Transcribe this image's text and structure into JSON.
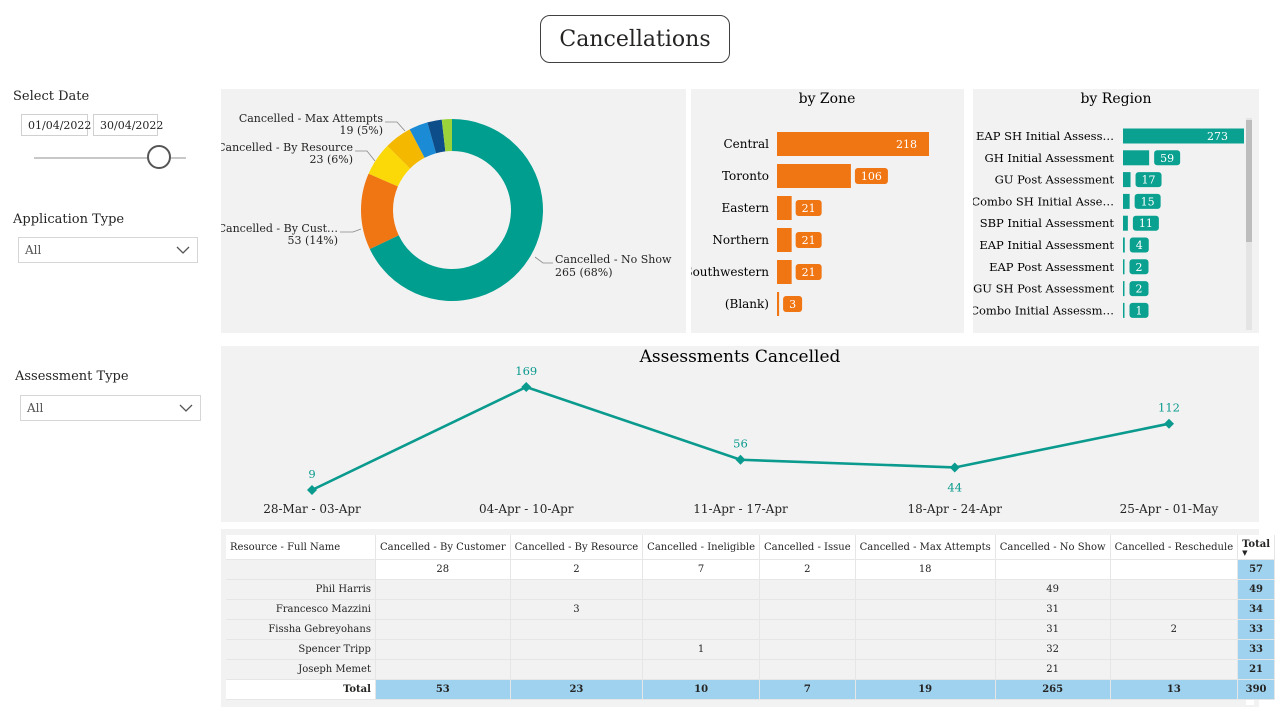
{
  "page_title": "Cancellations",
  "filters": {
    "select_date_label": "Select Date",
    "date_start": "01/04/2022",
    "date_end": "30/04/2022",
    "application_type_label": "Application Type",
    "application_type_value": "All",
    "assessment_type_label": "Assessment Type",
    "assessment_type_value": "All"
  },
  "donut": {
    "labels": [
      {
        "name": "Cancelled - Max Attempts",
        "value": "19 (5%)"
      },
      {
        "name": "Cancelled - By Resource",
        "value": "23 (6%)"
      },
      {
        "name": "Cancelled - By Cust…",
        "value": "53 (14%)"
      },
      {
        "name": "Cancelled - No Show",
        "value": "265 (68%)"
      }
    ],
    "slices": [
      {
        "value": 265,
        "color": "#009e8e"
      },
      {
        "value": 53,
        "color": "#f07513"
      },
      {
        "value": 23,
        "color": "#fbd808"
      },
      {
        "value": 19,
        "color": "#f5b800"
      },
      {
        "value": 13,
        "color": "#1a8bd4"
      },
      {
        "value": 10,
        "color": "#0d4e8a"
      },
      {
        "value": 7,
        "color": "#9ad43a"
      }
    ]
  },
  "zone": {
    "title": "by Zone",
    "color": "#f07513",
    "items": [
      {
        "label": "Central",
        "value": 218
      },
      {
        "label": "Toronto",
        "value": 106
      },
      {
        "label": "Eastern",
        "value": 21
      },
      {
        "label": "Northern",
        "value": 21
      },
      {
        "label": "Southwestern",
        "value": 21
      },
      {
        "label": "(Blank)",
        "value": 3
      }
    ]
  },
  "region": {
    "title": "by Region",
    "color": "#0aa191",
    "items": [
      {
        "label": "EAP SH Initial Assess…",
        "value": 273
      },
      {
        "label": "GH Initial Assessment",
        "value": 59
      },
      {
        "label": "GU Post Assessment",
        "value": 17
      },
      {
        "label": "Combo SH Initial Asse…",
        "value": 15
      },
      {
        "label": "SBP Initial Assessment",
        "value": 11
      },
      {
        "label": "EAP Initial Assessment",
        "value": 4
      },
      {
        "label": "EAP Post Assessment",
        "value": 2
      },
      {
        "label": "GU SH Post Assessment",
        "value": 2
      },
      {
        "label": "Combo Initial Assessm…",
        "value": 1
      }
    ]
  },
  "chart_data": {
    "type": "line",
    "title": "Assessments Cancelled",
    "categories": [
      "28-Mar - 03-Apr",
      "04-Apr - 10-Apr",
      "11-Apr - 17-Apr",
      "18-Apr - 24-Apr",
      "25-Apr - 01-May"
    ],
    "series": [
      {
        "values": [
          9,
          169,
          56,
          44,
          112
        ]
      }
    ],
    "color": "#0a9a8e",
    "xlabel": "",
    "ylabel": "",
    "grid": false
  },
  "matrix": {
    "columns": [
      "Resource - Full Name",
      "Cancelled - By Customer",
      "Cancelled - By Resource",
      "Cancelled - Ineligible",
      "Cancelled - Issue",
      "Cancelled - Max Attempts",
      "Cancelled - No Show",
      "Cancelled - Reschedule",
      "Total"
    ],
    "rows": [
      [
        "",
        "28",
        "2",
        "7",
        "2",
        "18",
        "",
        "",
        "57"
      ],
      [
        "Phil Harris",
        "",
        "",
        "",
        "",
        "",
        "49",
        "",
        "49"
      ],
      [
        "Francesco Mazzini",
        "",
        "3",
        "",
        "",
        "",
        "31",
        "",
        "34"
      ],
      [
        "Fissha Gebreyohans",
        "",
        "",
        "",
        "",
        "",
        "31",
        "2",
        "33"
      ],
      [
        "Spencer Tripp",
        "",
        "",
        "1",
        "",
        "",
        "32",
        "",
        "33"
      ],
      [
        "Joseph Memet",
        "",
        "",
        "",
        "",
        "",
        "21",
        "",
        "21"
      ]
    ],
    "total_row": [
      "Total",
      "53",
      "23",
      "10",
      "7",
      "19",
      "265",
      "13",
      "390"
    ]
  }
}
